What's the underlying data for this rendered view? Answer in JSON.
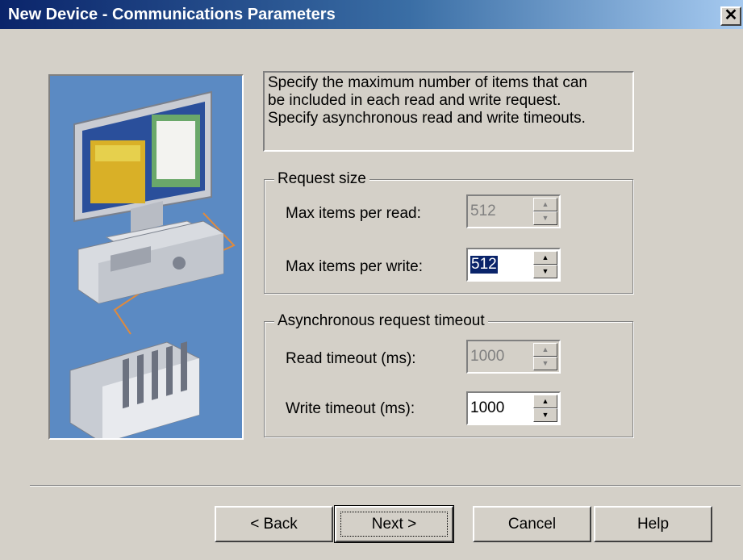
{
  "window": {
    "title": "New Device - Communications Parameters",
    "close_glyph": "✕"
  },
  "description": {
    "lines": [
      "Specify the maximum number of items that can",
      "be included in each read and write request.",
      "Specify asynchronous read and write timeouts."
    ]
  },
  "request_size": {
    "legend": "Request size",
    "max_read_label": "Max items per read:",
    "max_read_value": "512",
    "max_write_label": "Max items per write:",
    "max_write_value": "512"
  },
  "timeout": {
    "legend": "Asynchronous request timeout",
    "read_label": "Read timeout (ms):",
    "read_value": "1000",
    "write_label": "Write timeout (ms):",
    "write_value": "1000"
  },
  "buttons": {
    "back": "< Back",
    "next": "Next >",
    "cancel": "Cancel",
    "help": "Help"
  },
  "icons": {
    "close": "close-icon",
    "illustration": "computer-device-illustration",
    "spin_up": "▲",
    "spin_down": "▼"
  },
  "colors": {
    "title_bar_start": "#0a246a",
    "title_bar_end": "#a6caf0",
    "dialog_face": "#d4d0c8",
    "illustration_bg": "#5b8ac3",
    "selection": "#0a246a"
  }
}
